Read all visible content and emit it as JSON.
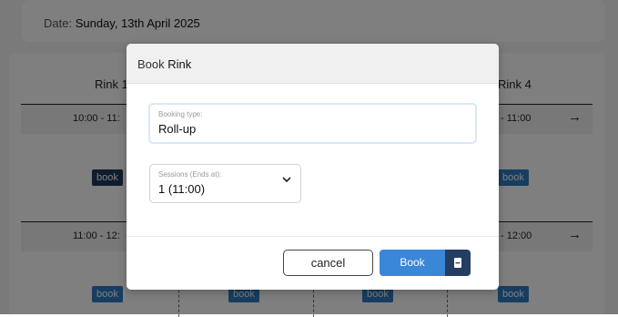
{
  "date": {
    "label": "Date:",
    "value": "Sunday, 13th April 2025"
  },
  "rinks": [
    "Rink 1",
    "Rink 4"
  ],
  "slots": [
    {
      "left_time": "10:00 - 11:",
      "right_time": "- 11:00",
      "arrow": "→"
    },
    {
      "left_time": "11:00 - 12:",
      "right_time": "- 12:00",
      "arrow": "→"
    }
  ],
  "book_label": "book",
  "modal": {
    "title_prefix": "Book",
    "title_suffix": "Rink",
    "booking_type": {
      "label": "Booking type:",
      "value": "Roll-up"
    },
    "sessions": {
      "label": "Sessions (Ends at):",
      "value": "1 (11:00)"
    },
    "cancel_label": "cancel",
    "book_label": "Book"
  },
  "colors": {
    "primary": "#3a86d8",
    "dark": "#243e63",
    "book_button": "#2f7cc4"
  },
  "icons": {
    "select": "chevron-down-icon",
    "book_extra": "bookmark-icon",
    "slot_next": "arrow-right-icon"
  }
}
